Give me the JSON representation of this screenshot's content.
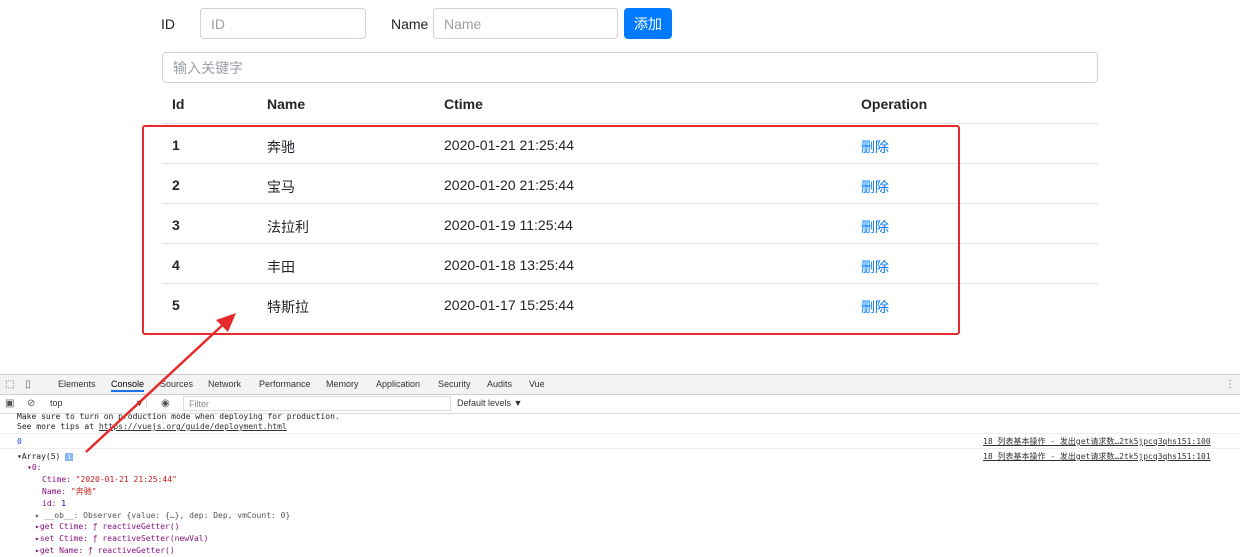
{
  "form": {
    "id_label": "ID",
    "id_placeholder": "ID",
    "name_label": "Name",
    "name_placeholder": "Name",
    "add_label": "添加",
    "search_placeholder": "输入关键字"
  },
  "table": {
    "headers": [
      "Id",
      "Name",
      "Ctime",
      "Operation"
    ],
    "rows": [
      {
        "id": "1",
        "name": "奔驰",
        "ctime": "2020-01-21 21:25:44",
        "op": "删除"
      },
      {
        "id": "2",
        "name": "宝马",
        "ctime": "2020-01-20 21:25:44",
        "op": "删除"
      },
      {
        "id": "3",
        "name": "法拉利",
        "ctime": "2020-01-19 11:25:44",
        "op": "删除"
      },
      {
        "id": "4",
        "name": "丰田",
        "ctime": "2020-01-18 13:25:44",
        "op": "删除"
      },
      {
        "id": "5",
        "name": "特斯拉",
        "ctime": "2020-01-17 15:25:44",
        "op": "删除"
      }
    ]
  },
  "annotation": {
    "box_color": "#e52b2b"
  },
  "devtools": {
    "tabs": [
      "Elements",
      "Console",
      "Sources",
      "Network",
      "Performance",
      "Memory",
      "Application",
      "Security",
      "Audits",
      "Vue"
    ],
    "active_tab": "Console",
    "context": "top",
    "filter_placeholder": "Filter",
    "levels": "Default levels ▼",
    "console": {
      "line1": "Make sure to turn on production mode when deploying for production.",
      "line2_prefix": "See more tips at ",
      "line2_link": "https://vuejs.org/guide/deployment.html",
      "log_zero": "0",
      "src1": "18 列表基本操作 - 发出get请求数…2tk5jpcq3qhs151:100",
      "array_label": "▾Array(5)",
      "src2": "18 列表基本操作 - 发出get请求数…2tk5jpcq3qhs151:101",
      "item0": "▾0:",
      "ctime_key": "Ctime:",
      "ctime_val": "\"2020-01-21 21:25:44\"",
      "name_key": "Name:",
      "name_val": "\"奔驰\"",
      "id_key": "id:",
      "id_val": "1",
      "ob_line": "▸ __ob__: Observer {value: {…}, dep: Dep, vmCount: 0}",
      "get_ctime": "▸get Ctime: ƒ reactiveGetter()",
      "set_ctime": "▸set Ctime: ƒ reactiveSetter(newVal)",
      "get_name": "▸get Name: ƒ reactiveGetter()"
    }
  },
  "colors": {
    "accent": "#007bff",
    "annotation": "#e52b2b"
  }
}
